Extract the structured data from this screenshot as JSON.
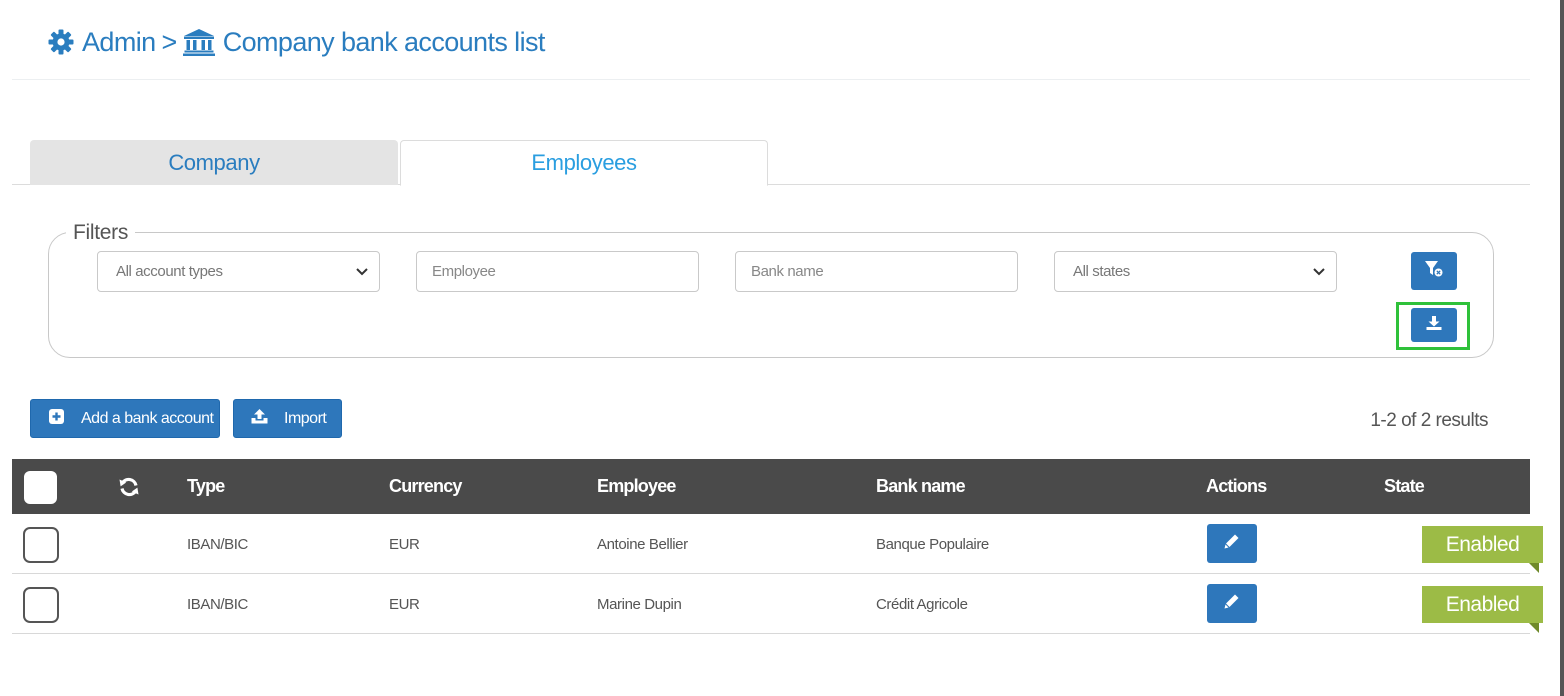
{
  "breadcrumb": {
    "root": "Admin",
    "separator": ">",
    "current": "Company bank accounts list"
  },
  "tabs": [
    {
      "label": "Company",
      "active": false
    },
    {
      "label": "Employees",
      "active": true
    }
  ],
  "filters": {
    "legend": "Filters",
    "account_type": {
      "value": "All account types"
    },
    "employee": {
      "placeholder": "Employee"
    },
    "bank_name": {
      "placeholder": "Bank name"
    },
    "state": {
      "value": "All states"
    }
  },
  "actions": {
    "add_label": "Add a bank account",
    "import_label": "Import"
  },
  "results": "1-2 of 2 results",
  "table": {
    "headers": {
      "type": "Type",
      "currency": "Currency",
      "employee": "Employee",
      "bank_name": "Bank name",
      "actions": "Actions",
      "state": "State"
    },
    "rows": [
      {
        "type": "IBAN/BIC",
        "currency": "EUR",
        "employee": "Antoine Bellier",
        "bank_name": "Banque Populaire",
        "state": "Enabled"
      },
      {
        "type": "IBAN/BIC",
        "currency": "EUR",
        "employee": "Marine Dupin",
        "bank_name": "Crédit Agricole",
        "state": "Enabled"
      }
    ]
  },
  "icons": {
    "header": [
      "gear-icon",
      "bank-icon"
    ],
    "filters": [
      "chevron-down-icon",
      "filter-clear-icon",
      "download-icon"
    ],
    "buttons": [
      "plus-square-icon",
      "upload-icon"
    ],
    "table": [
      "refresh-icon",
      "pencil-icon"
    ]
  },
  "colors": {
    "primary": "#2e77bb",
    "link": "#2a7dbf",
    "table_header": "#4a4a4a",
    "state_enabled": "#9cbb46",
    "highlight": "#2fc13a"
  }
}
